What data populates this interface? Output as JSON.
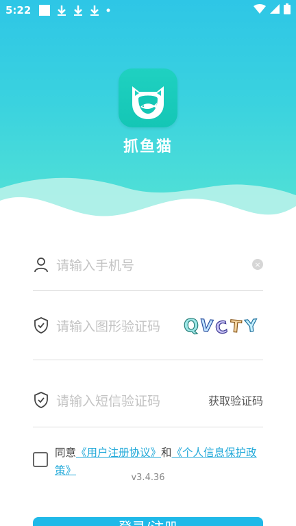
{
  "status_bar": {
    "time": "5:22",
    "icons": [
      "square-icon",
      "download-icon",
      "download-icon",
      "download-icon",
      "dot-icon"
    ],
    "right_icons": [
      "wifi-icon",
      "signal-icon",
      "battery-icon"
    ]
  },
  "app": {
    "name": "抓鱼猫",
    "logo_icon": "cat-fish-logo-icon"
  },
  "form": {
    "phone_placeholder": "请输入手机号",
    "captcha_placeholder": "请输入图形验证码",
    "captcha_text": "QVCTY",
    "sms_placeholder": "请输入短信验证码",
    "get_code_label": "获取验证码"
  },
  "agreement": {
    "prefix": "同意",
    "user_agreement": "《用户注册协议》",
    "and": "和",
    "privacy_policy": "《个人信息保护政策》"
  },
  "version": "v3.4.36",
  "login_button": "登录/注册",
  "colors": {
    "header_top": "#2ec6e6",
    "header_bottom": "#55e3d4",
    "accent": "#1fb9e8",
    "link": "#21a9d9"
  }
}
